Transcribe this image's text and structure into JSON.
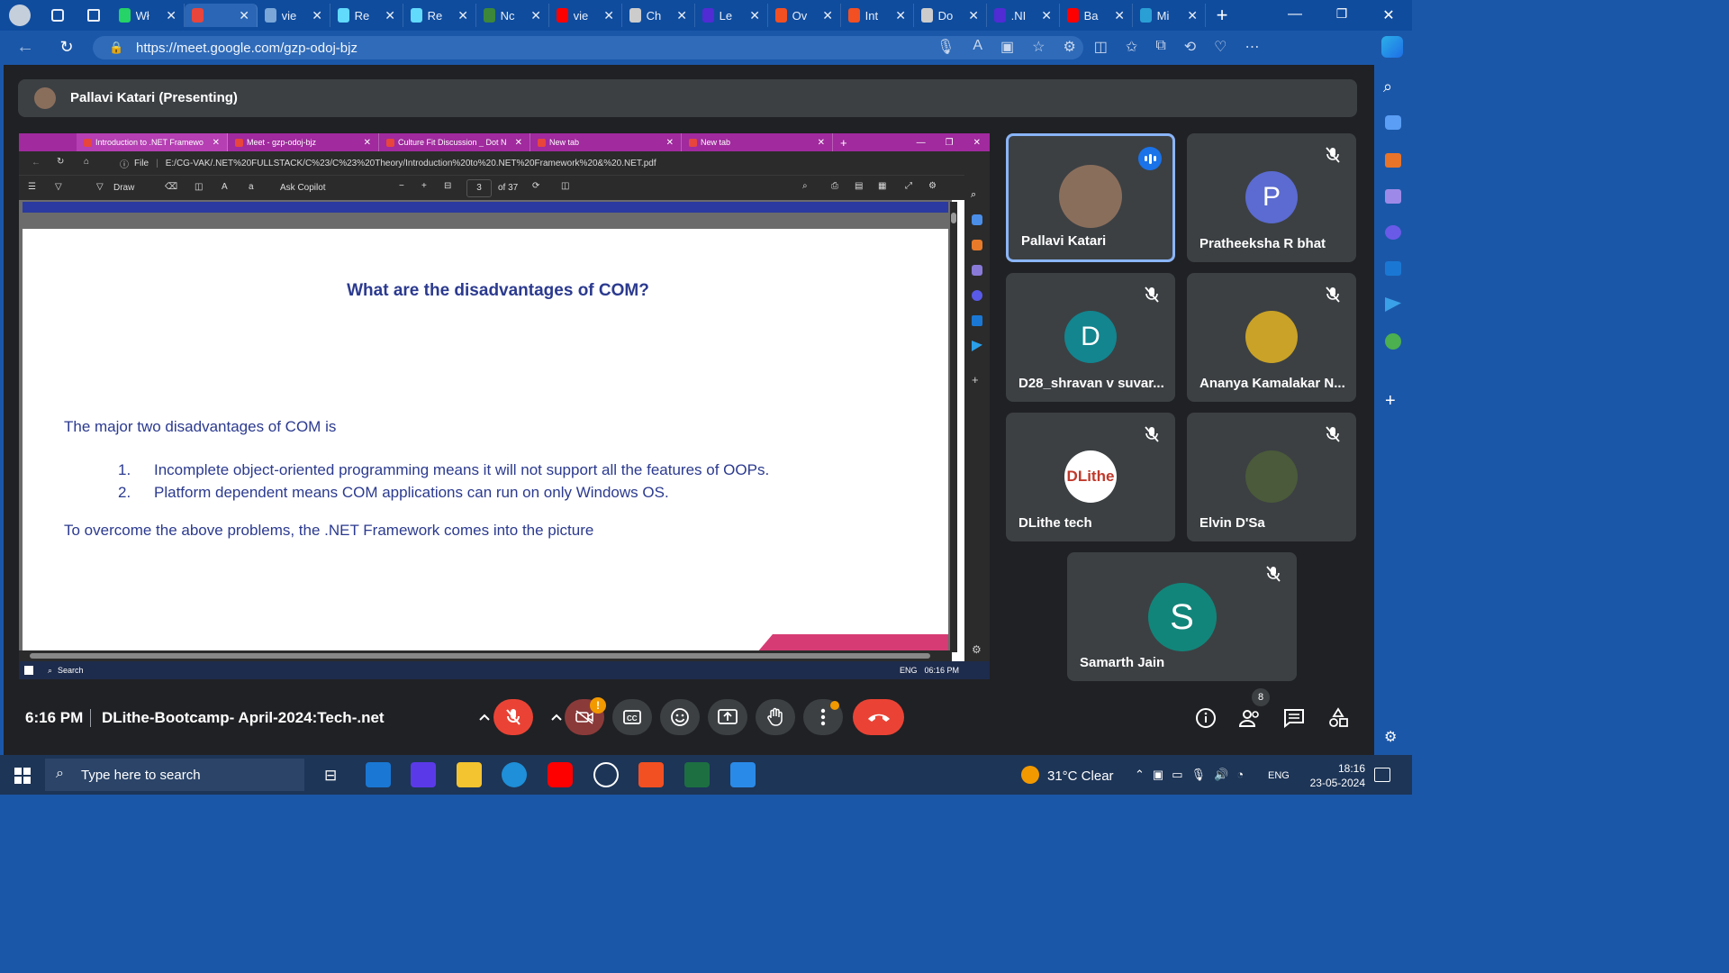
{
  "browser": {
    "tabs": [
      {
        "label": "Wł",
        "icon": "whatsapp-icon",
        "color": "#25d366"
      },
      {
        "label": "",
        "icon": "meet-icon",
        "color": "#e8453c",
        "active": true
      },
      {
        "label": "vie",
        "icon": "settings-gear-icon",
        "color": "#7aa7d8"
      },
      {
        "label": "Re",
        "icon": "react-icon",
        "color": "#61dafb"
      },
      {
        "label": "Re",
        "icon": "react-icon",
        "color": "#61dafb"
      },
      {
        "label": "Nc",
        "icon": "node-icon",
        "color": "#3c873a"
      },
      {
        "label": "vie",
        "icon": "youtube-icon",
        "color": "#ff0000"
      },
      {
        "label": "Ch",
        "icon": "chatgpt-icon",
        "color": "#cccccc"
      },
      {
        "label": "Le",
        "icon": "dotnet-icon",
        "color": "#512bd4"
      },
      {
        "label": "Ov",
        "icon": "microsoft-icon",
        "color": "#f25022"
      },
      {
        "label": "Int",
        "icon": "microsoft-icon",
        "color": "#f25022"
      },
      {
        "label": "Do",
        "icon": "document-icon",
        "color": "#cccccc"
      },
      {
        "label": ".NI",
        "icon": "dotnet-icon",
        "color": "#512bd4"
      },
      {
        "label": "Ba",
        "icon": "youtube-icon",
        "color": "#ff0000"
      },
      {
        "label": "Mi",
        "icon": "edge-icon",
        "color": "#2a9fd6"
      }
    ],
    "url": "https://meet.google.com/gzp-odoj-bjz"
  },
  "presenter": {
    "label": "Pallavi Katari (Presenting)"
  },
  "shared_screen": {
    "tabs": [
      {
        "label": "Introduction to .NET Framework",
        "active": true
      },
      {
        "label": "Meet - gzp-odoj-bjz"
      },
      {
        "label": "Culture Fit Discussion _ Dot Net"
      },
      {
        "label": "New tab"
      },
      {
        "label": "New tab"
      }
    ],
    "file_label": "File",
    "path": "E:/CG-VAK/.NET%20FULLSTACK/C%23/C%23%20Theory/Introduction%20to%20.NET%20Framework%20&%20.NET.pdf",
    "toolbar": {
      "draw": "Draw",
      "ask_copilot": "Ask Copilot",
      "page": "3",
      "of_pages": "of 37"
    },
    "pdf": {
      "title": "What are the disadvantages of COM?",
      "intro": "The major two disadvantages of COM is",
      "items": [
        {
          "num": "1.",
          "text": "Incomplete object-oriented programming means it will not support all the features of OOPs."
        },
        {
          "num": "2.",
          "text": "Platform dependent means COM applications can run on only Windows OS."
        }
      ],
      "conclusion": "To overcome the above problems, the .NET Framework comes into the picture"
    },
    "inner_taskbar": {
      "search": "Search",
      "lang": "ENG",
      "time": "06:16 PM"
    }
  },
  "participants": [
    {
      "name": "Pallavi Katari",
      "initial": "",
      "color": "#8a6e5c",
      "speaking": true
    },
    {
      "name": "Pratheeksha R bhat",
      "initial": "P",
      "color": "#5b6bd1",
      "muted": true
    },
    {
      "name": "D28_shravan v suvar...",
      "initial": "D",
      "color": "#12858f",
      "muted": true
    },
    {
      "name": "Ananya Kamalakar N...",
      "initial": "",
      "color": "#c9a227",
      "muted": true
    },
    {
      "name": "DLithe tech",
      "initial": "DLithe",
      "color": "#ffffff",
      "muted": true
    },
    {
      "name": "Elvin D'Sa",
      "initial": "",
      "color": "#4a5a3a",
      "muted": true
    },
    {
      "name": "Samarth Jain",
      "initial": "S",
      "color": "#12857a",
      "muted": true
    }
  ],
  "meeting": {
    "time": "6:16 PM",
    "name": "DLithe-Bootcamp- April-2024:Tech-.net",
    "participant_count": "8"
  },
  "taskbar": {
    "search_placeholder": "Type here to search",
    "weather": "31°C  Clear",
    "lang": "ENG",
    "time": "18:16",
    "date": "23-05-2024"
  }
}
